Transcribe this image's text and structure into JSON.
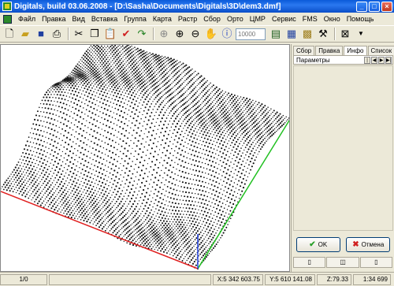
{
  "window": {
    "title": "Digitals, build 03.06.2008 - [D:\\Sasha\\Documents\\Digitals\\3D\\dem3.dmf]"
  },
  "menu": {
    "items": [
      "Файл",
      "Правка",
      "Вид",
      "Вставка",
      "Группа",
      "Карта",
      "Растр",
      "Сбор",
      "Орто",
      "ЦМР",
      "Сервис",
      "FMS",
      "Окно",
      "Помощь"
    ]
  },
  "toolbar": {
    "scale_placeholder": "10000"
  },
  "panel": {
    "tabs": [
      "Сбор",
      "Правка",
      "Инфо",
      "Список"
    ],
    "active_tab": "Инфо",
    "params_label": "Параметры",
    "ok_label": "OK",
    "cancel_label": "Отмена"
  },
  "status": {
    "page": "1/0",
    "x": "X:5 342 603.75",
    "y": "Y:5 610 141.08",
    "z": "Z:79.33",
    "scale": "1:34 699"
  },
  "colors": {
    "title_bar": "#0a5ad8",
    "axis_red": "#e02020",
    "axis_green": "#20c020",
    "axis_blue": "#2040e0"
  }
}
